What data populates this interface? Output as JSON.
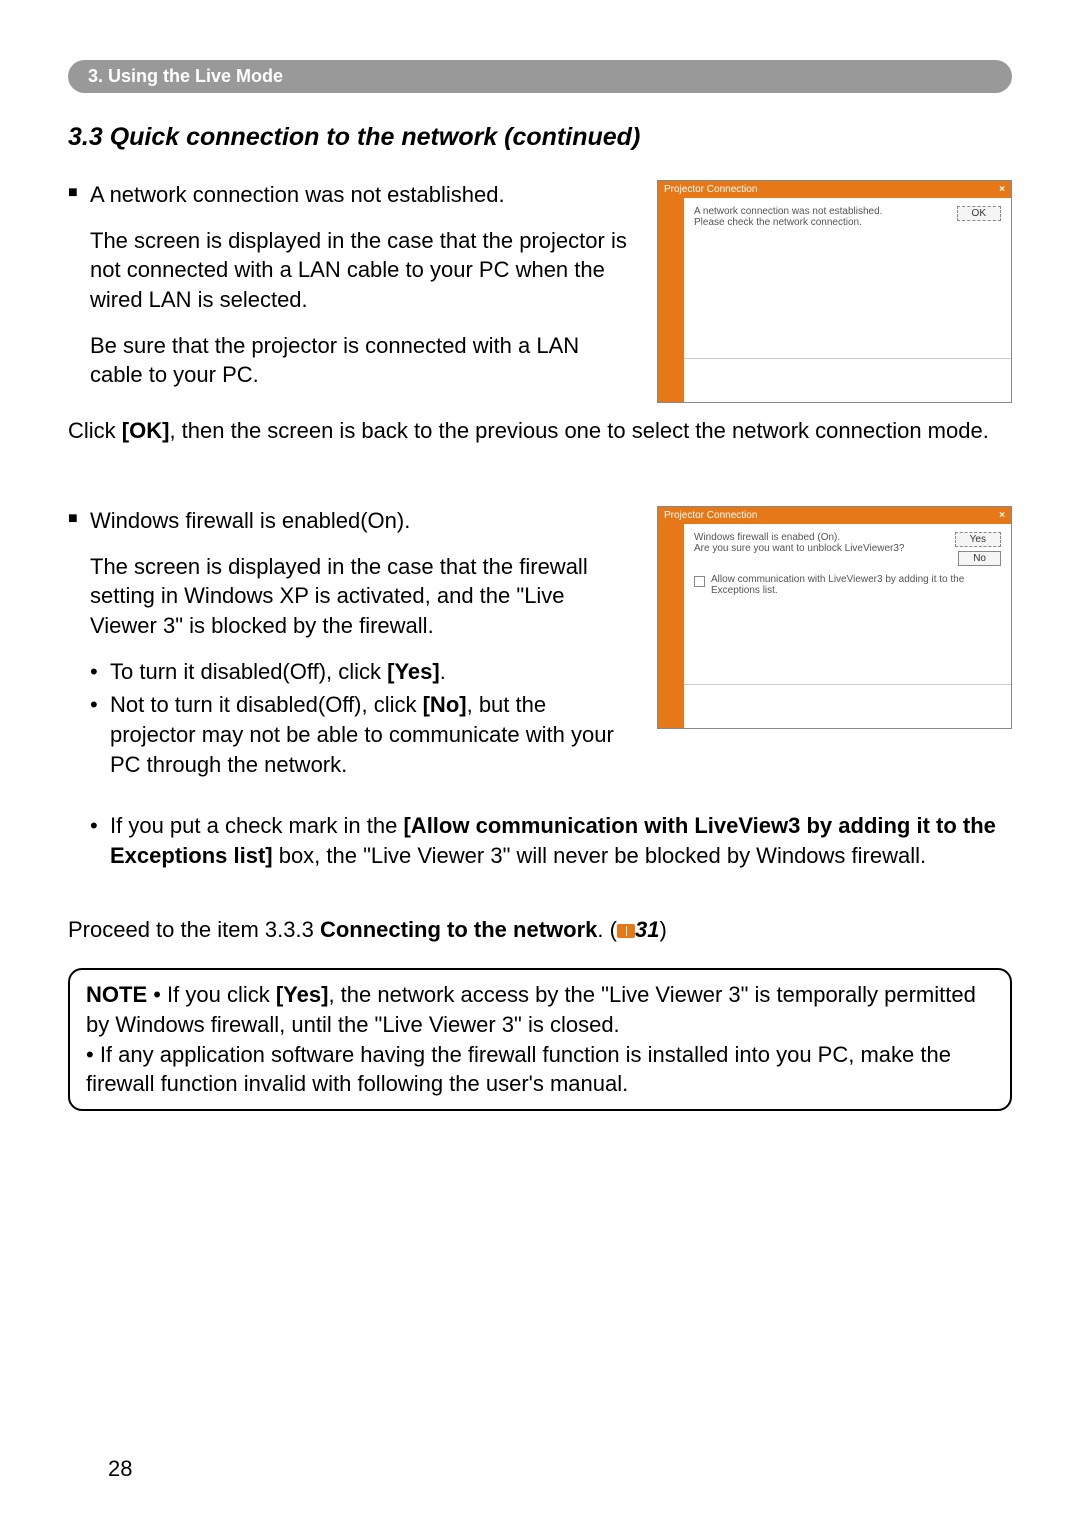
{
  "header": {
    "breadcrumb": "3. Using the Live Mode"
  },
  "section": {
    "title": "3.3 Quick connection to the network (continued)"
  },
  "block1": {
    "heading": "A network connection was not established.",
    "p1": "The screen is displayed in the case that the projector is not connected with a LAN cable to your PC when the wired LAN is selected.",
    "p2": "Be sure that the projector is connected with a LAN cable to your PC."
  },
  "dialog1": {
    "title": "Projector Connection",
    "line1": "A network connection was not established.",
    "line2": "Please check the network connection.",
    "ok": "OK"
  },
  "after1": {
    "p": "Click [OK], then the screen is back to the previous one to select the network connection mode.",
    "pre": "Click ",
    "bold": "[OK]",
    "post": ", then the screen is back to the previous one to select the network connection mode."
  },
  "block2": {
    "heading": "Windows firewall is enabled(On).",
    "p1": "The screen is displayed in the case that the firewall setting in Windows XP is activated, and the \"Live Viewer 3\" is blocked by the firewall.",
    "bullets": {
      "b1pre": "To turn it disabled(Off), click ",
      "b1bold": "[Yes]",
      "b1post": ".",
      "b2pre": "Not to turn it disabled(Off), click ",
      "b2bold": "[No]",
      "b2post": ", but the projector may not be able to communicate with your PC through the network."
    },
    "b3pre": "If you put a check mark in the ",
    "b3bold": "[Allow communication with LiveView3 by adding it to the Exceptions list]",
    "b3post": " box, the \"Live Viewer 3\" will never be blocked by Windows firewall."
  },
  "dialog2": {
    "title": "Projector Connection",
    "line1": "Windows firewall is enabed (On).",
    "line2": "Are you sure you want to unblock LiveViewer3?",
    "checkbox": "Allow communication with LiveViewer3 by adding it to the Exceptions list.",
    "yes": "Yes",
    "no": "No"
  },
  "proceed": {
    "pre": "Proceed to the item 3.3.3 ",
    "bold": "Connecting to the network",
    "post": ". (",
    "ref": "31",
    "close": ")"
  },
  "note": {
    "label": "NOTE",
    "t1pre": " • If you click ",
    "t1bold": "[Yes]",
    "t1post": ", the network access by the \"Live Viewer 3\" is temporally permitted by Windows firewall, until the \"Live Viewer 3\" is closed.",
    "t2": "• If any application software having the firewall function is installed into you PC, make the firewall function invalid with following the user's manual."
  },
  "page": "28"
}
